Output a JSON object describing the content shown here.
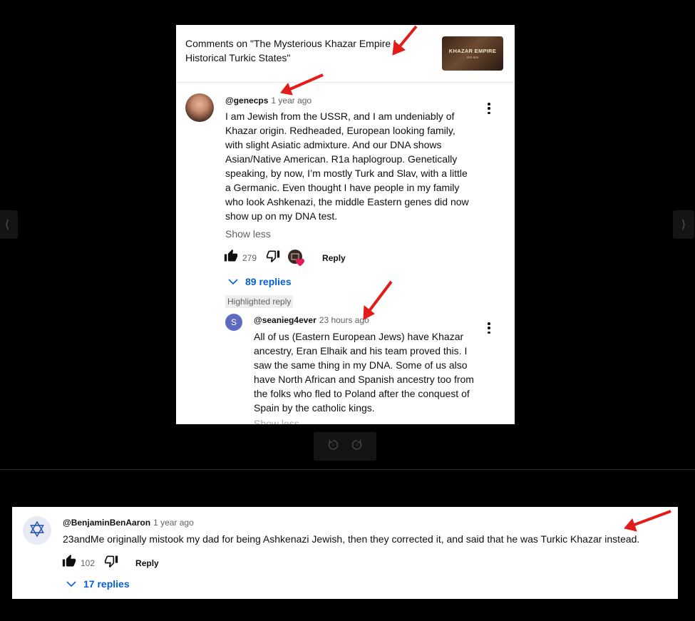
{
  "top_post": {
    "header": {
      "title": "Comments on \"The Mysterious Khazar Empire | Historical Turkic States\"",
      "thumbnail": {
        "title": "KHAZAR EMPIRE",
        "subtitle": "650-969"
      }
    },
    "comment": {
      "handle": "@genecps",
      "time": "1 year ago",
      "text": "I am Jewish from the USSR, and I am undeniably of Khazar origin. Redheaded, European looking family, with slight Asiatic admixture. And our DNA shows Asian/Native American. R1a haplogroup. Genetically speaking, by now, I’m mostly Turk and Slav, with a little a Germanic. Even thought I have people in my family who look Ashkenazi, the middle Eastern genes did now show up on my DNA test.",
      "show_less": "Show less",
      "likes": "279",
      "reply_label": "Reply",
      "replies_label": "89 replies"
    },
    "highlighted_reply": {
      "badge": "Highlighted reply",
      "avatar_letter": "S",
      "handle": "@seanieg4ever",
      "time": "23 hours ago",
      "text": "All of us (Eastern European Jews) have Khazar ancestry, Eran Elhaik and his team proved this.  I saw the same thing in my DNA.  Some of us also have North African and Spanish ancestry too from the folks who fled to Poland after the conquest of Spain by the catholic kings.",
      "show_less": "Show less"
    }
  },
  "bottom_post": {
    "handle": "@BenjaminBenAaron",
    "time": "1 year ago",
    "text": "23andMe originally mistook my dad for being Ashkenazi Jewish, then they corrected it, and said that he was Turkic Khazar instead.",
    "likes": "102",
    "reply_label": "Reply",
    "replies_label": "17 replies"
  },
  "viewer_nav": {
    "prev_icon": "chevron-left-icon",
    "next_icon": "chevron-right-icon"
  },
  "colors": {
    "annotation_arrow": "#e21b1b",
    "link_blue": "#065fd4",
    "heart": "#e31b54"
  }
}
